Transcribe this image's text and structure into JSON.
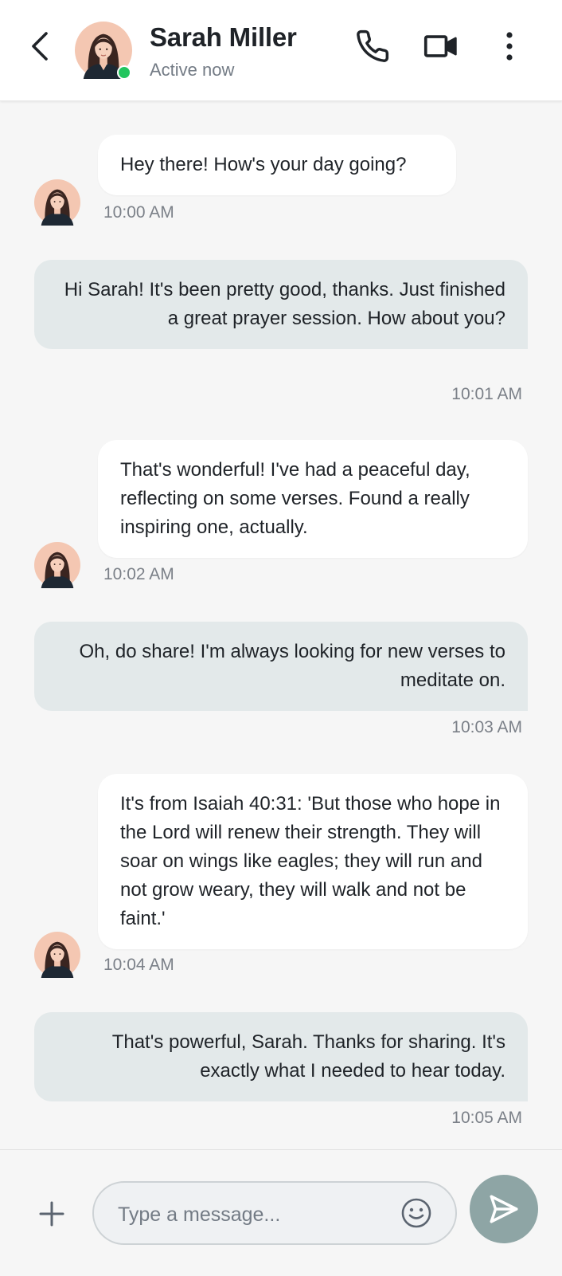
{
  "header": {
    "contact_name": "Sarah Miller",
    "status": "Active now",
    "icons": {
      "back": "chevron-left-icon",
      "call": "phone-icon",
      "video": "video-camera-icon",
      "more": "more-vertical-icon"
    },
    "online_color": "#22c55e"
  },
  "messages": [
    {
      "direction": "incoming",
      "text": "Hey there! How's your day going?",
      "time": "10:00 AM"
    },
    {
      "direction": "outgoing",
      "text": "Hi Sarah! It's been pretty good, thanks. Just finished a great prayer session. How about you?",
      "time": "10:01 AM"
    },
    {
      "direction": "incoming",
      "text": "That's wonderful! I've had a peaceful day, reflecting on some verses. Found a really inspiring one, actually.",
      "time": "10:02 AM"
    },
    {
      "direction": "outgoing",
      "text": "Oh, do share! I'm always looking for new verses to meditate on.",
      "time": "10:03 AM"
    },
    {
      "direction": "incoming",
      "text": "It's from Isaiah 40:31: 'But those who hope in the Lord will renew their strength. They will soar on wings like eagles; they will run and not grow weary, they will walk and not be faint.'",
      "time": "10:04 AM"
    },
    {
      "direction": "outgoing",
      "text": "That's powerful, Sarah. Thanks for sharing. It's exactly what I needed to hear today.",
      "time": "10:05 AM"
    }
  ],
  "composer": {
    "placeholder": "Type a message...",
    "icons": {
      "add": "plus-icon",
      "emoji": "smiley-icon",
      "send": "send-icon"
    }
  },
  "colors": {
    "background": "#f6f6f6",
    "incoming_bubble": "#ffffff",
    "outgoing_bubble": "#e3e9ea",
    "send_button": "#8ea5a5"
  }
}
